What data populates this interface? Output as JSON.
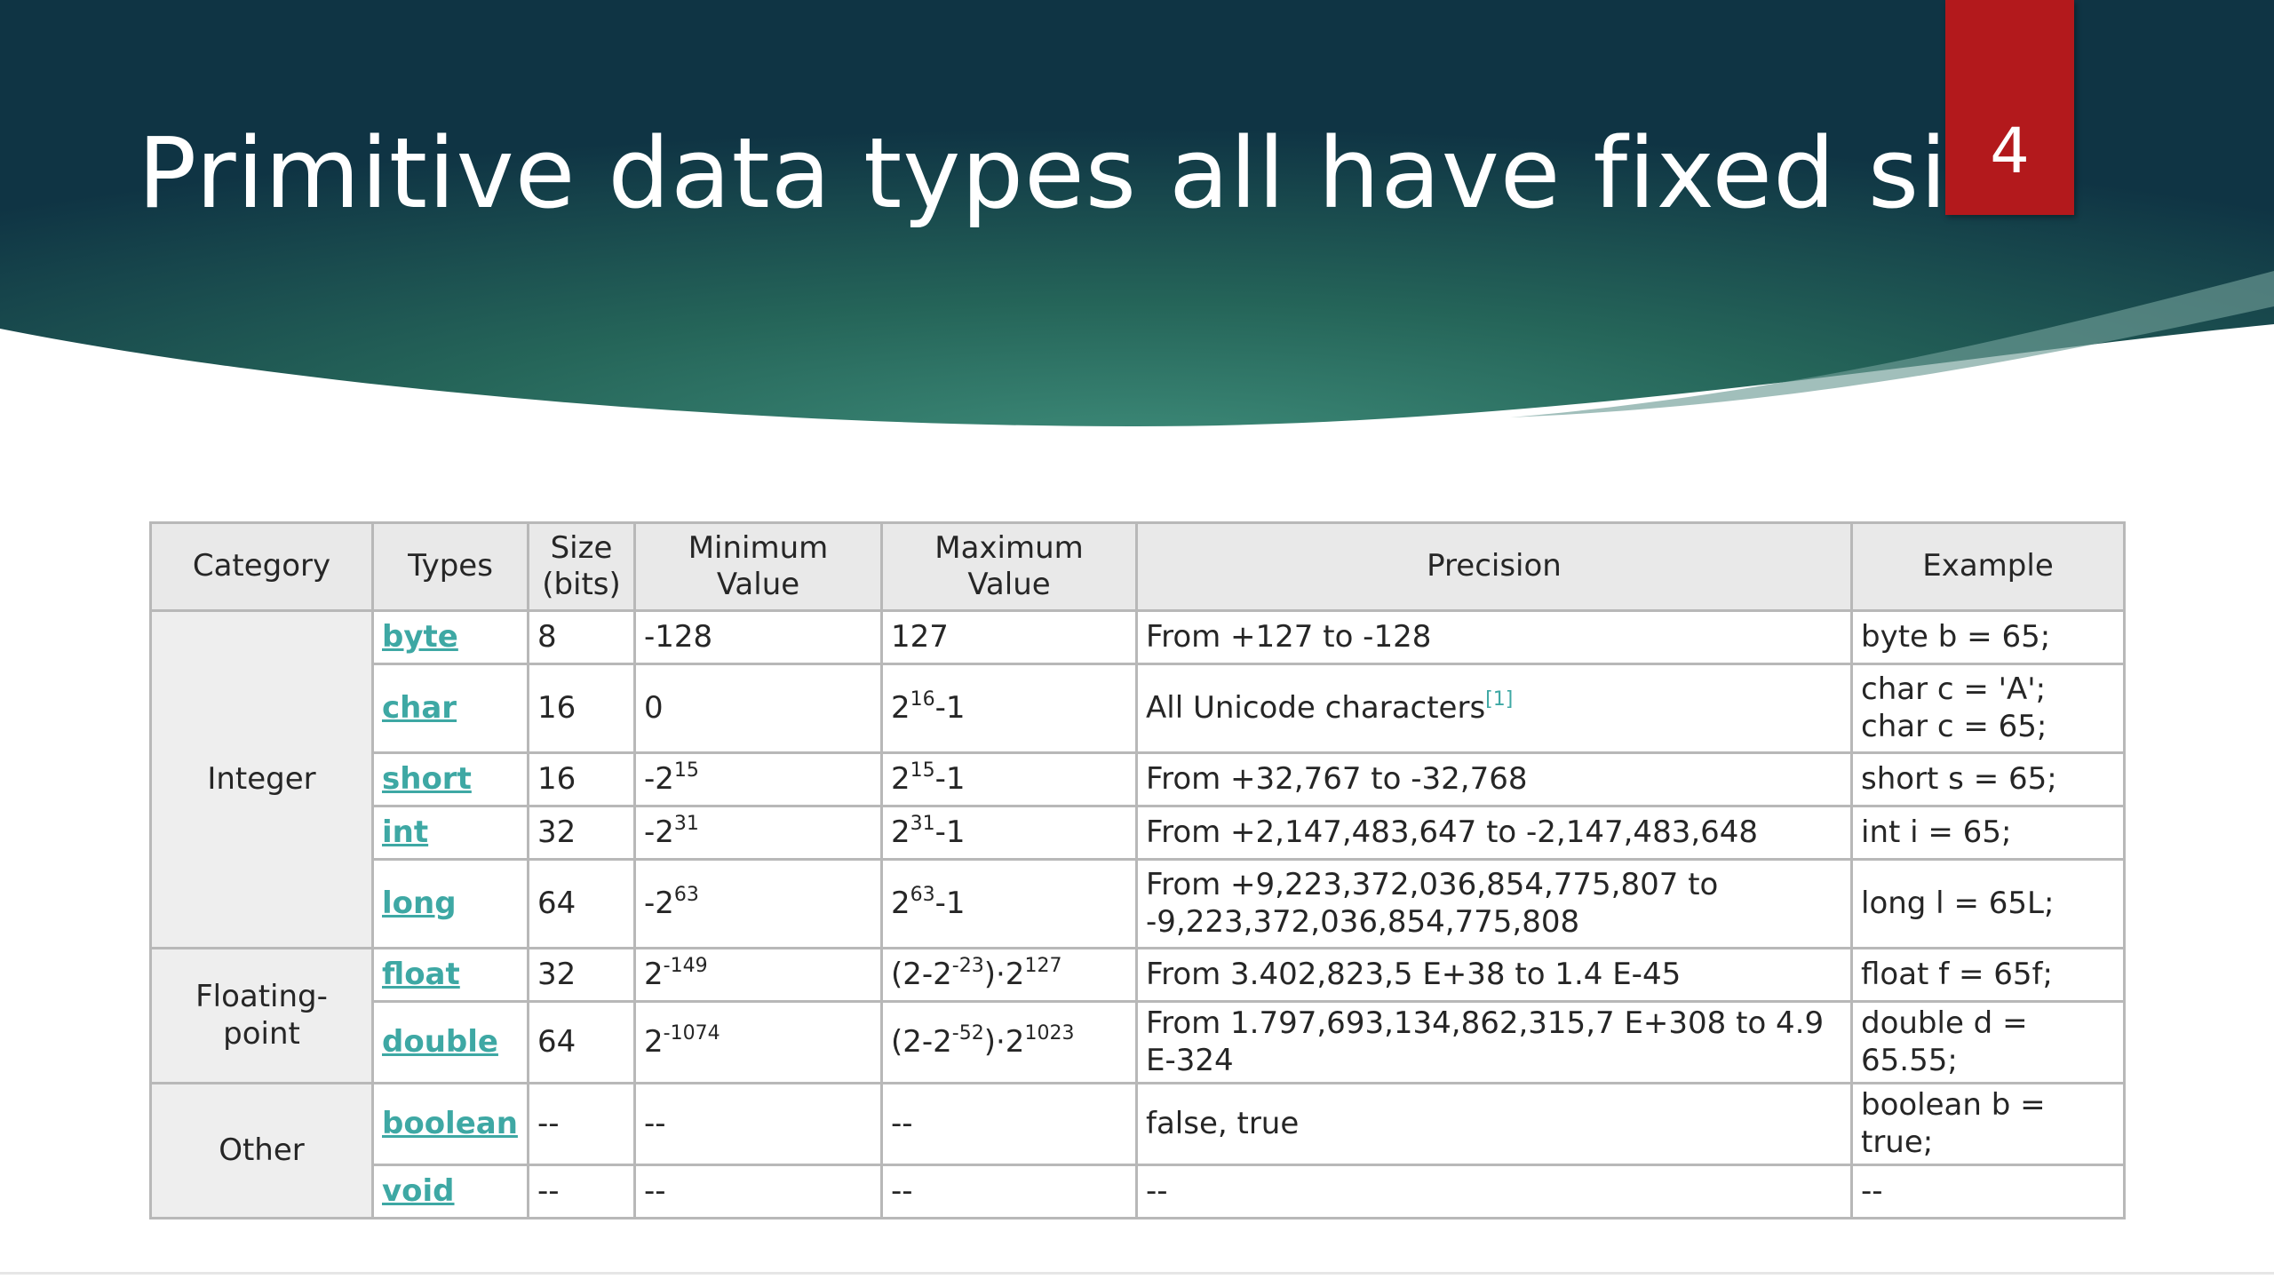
{
  "slide": {
    "title": "Primitive data types all have fixed size",
    "page_number": "4",
    "colors": {
      "header_dark": "#133d4a",
      "header_mid": "#2c6d66",
      "badge": "#b3191c",
      "link": "#3ea8a4"
    }
  },
  "table": {
    "headers": {
      "category": "Category",
      "types": "Types",
      "size": "Size (bits)",
      "min": "Minimum Value",
      "max": "Maximum Value",
      "precision": "Precision",
      "example": "Example"
    },
    "categories": {
      "integer": "Integer",
      "floating": "Floating-point",
      "other": "Other"
    },
    "rows": [
      {
        "type": "byte",
        "size": "8",
        "min": {
          "text": "-128"
        },
        "max": {
          "text": "127"
        },
        "precision": "From +127 to -128",
        "example": [
          "byte b = 65;"
        ]
      },
      {
        "type": "char",
        "size": "16",
        "min": {
          "text": "0"
        },
        "max": {
          "base": "2",
          "exp": "16",
          "tail": "-1"
        },
        "precision": "All Unicode characters",
        "precision_ref": "[1]",
        "example": [
          "char c = 'A';",
          "char c = 65;"
        ]
      },
      {
        "type": "short",
        "size": "16",
        "min": {
          "base": "-2",
          "exp": "15"
        },
        "max": {
          "base": "2",
          "exp": "15",
          "tail": "-1"
        },
        "precision": "From +32,767 to -32,768",
        "example": [
          "short s = 65;"
        ]
      },
      {
        "type": "int",
        "size": "32",
        "min": {
          "base": "-2",
          "exp": "31"
        },
        "max": {
          "base": "2",
          "exp": "31",
          "tail": "-1"
        },
        "precision": "From +2,147,483,647 to -2,147,483,648",
        "example": [
          "int i = 65;"
        ]
      },
      {
        "type": "long",
        "size": "64",
        "min": {
          "base": "-2",
          "exp": "63"
        },
        "max": {
          "base": "2",
          "exp": "63",
          "tail": "-1"
        },
        "precision": "From +9,223,372,036,854,775,807 to -9,223,372,036,854,775,808",
        "example": [
          "long l = 65L;"
        ]
      },
      {
        "type": "float",
        "size": "32",
        "min": {
          "base": "2",
          "exp": "-149"
        },
        "max": {
          "p1": "(2-2",
          "e1": "-23",
          "p2": ")·2",
          "e2": "127"
        },
        "precision": "From 3.402,823,5 E+38 to 1.4 E-45",
        "example": [
          "float f = 65f;"
        ]
      },
      {
        "type": "double",
        "size": "64",
        "min": {
          "base": "2",
          "exp": "-1074"
        },
        "max": {
          "p1": "(2-2",
          "e1": "-52",
          "p2": ")·2",
          "e2": "1023"
        },
        "precision": "From 1.797,693,134,862,315,7 E+308 to 4.9 E-324",
        "example": [
          "double d = 65.55;"
        ]
      },
      {
        "type": "boolean",
        "size": "--",
        "min": {
          "text": "--"
        },
        "max": {
          "text": "--"
        },
        "precision": "false, true",
        "example": [
          "boolean b = true;"
        ]
      },
      {
        "type": "void",
        "size": "--",
        "min": {
          "text": "--"
        },
        "max": {
          "text": "--"
        },
        "precision": "--",
        "example": [
          "--"
        ]
      }
    ]
  }
}
